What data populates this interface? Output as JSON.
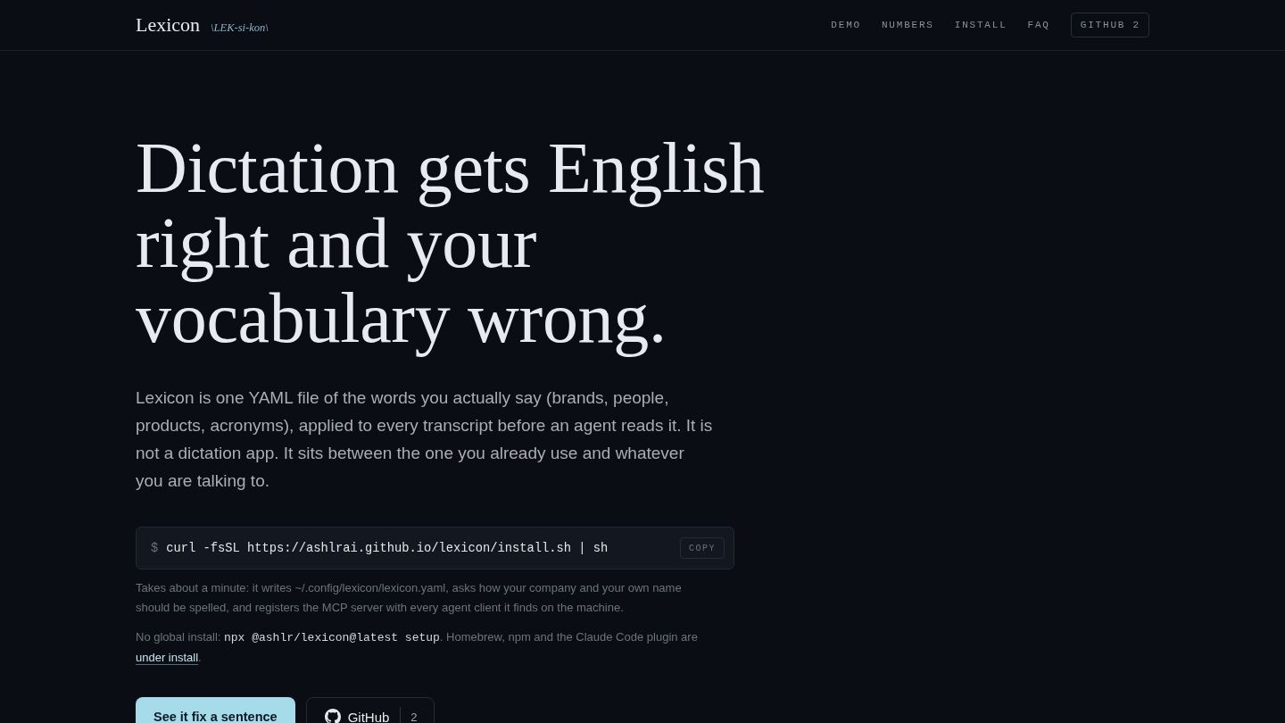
{
  "header": {
    "logo": "Lexicon",
    "pronunciation": "\\LEK-si-kon\\",
    "nav": [
      {
        "label": "DEMO",
        "kind": "link"
      },
      {
        "label": "NUMBERS",
        "kind": "link"
      },
      {
        "label": "INSTALL",
        "kind": "link"
      },
      {
        "label": "FAQ",
        "kind": "link"
      },
      {
        "label": "GITHUB 2",
        "kind": "outlined"
      }
    ]
  },
  "hero": {
    "headline": "Dictation gets English right and your vocabulary wrong.",
    "lead": "Lexicon is one YAML file of the words you actually say (brands, people, products, acronyms), applied to every transcript before an agent reads it. It is not a dictation app. It sits between the one you already use and whatever you are talking to."
  },
  "install": {
    "prompt": "$",
    "command": "curl -fsSL https://ashlrai.github.io/lexicon/install.sh | sh",
    "copy_button": "COPY",
    "note": "Takes about a minute: it writes ~/.config/lexicon/lexicon.yaml, asks how your company and your own name should be spelled, and registers the MCP server with every agent client it finds on the machine.",
    "alt_note": {
      "text_before": "No global install: ",
      "code": "npx @ashlr/lexicon@latest setup",
      "text_after": ". Homebrew, npm and the Claude Code plugin are ",
      "link": "under install",
      "text_end": "."
    }
  },
  "actions": [
    {
      "kind": "primary",
      "label": "See it fix a sentence"
    },
    {
      "kind": "repo",
      "label": "GitHub",
      "count": "2"
    }
  ]
}
